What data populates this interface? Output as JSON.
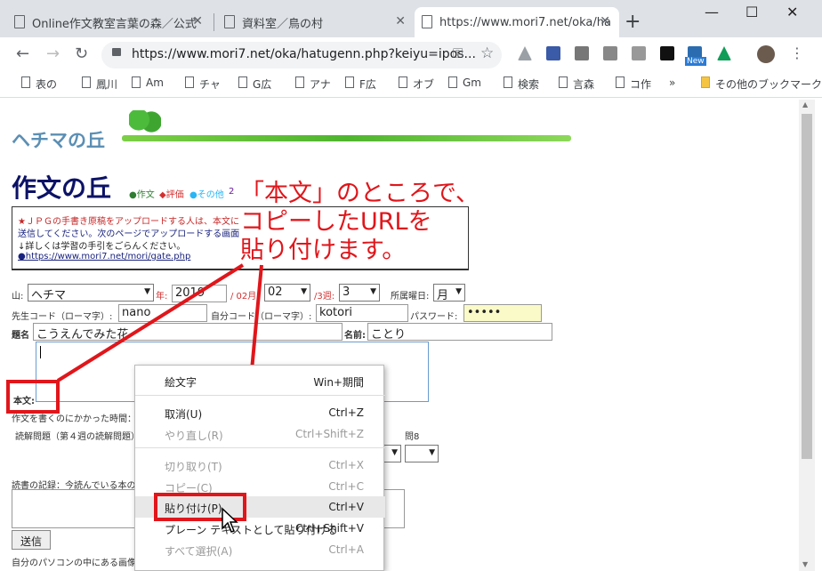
{
  "browser": {
    "tabs": [
      {
        "title": "Online作文教室言葉の森／公式"
      },
      {
        "title": "資料室／鳥の村"
      },
      {
        "title": "https://www.mori7.net/oka/ha"
      }
    ],
    "url": "https://www.mori7.net/oka/hatugenn.php?keiyu=ipos...",
    "bookmarks": [
      "表の",
      "鳳川",
      "Am",
      "チャ",
      "G広",
      "アナ",
      "F広",
      "オブ",
      "Gm",
      "検索",
      "言森",
      "コ作",
      "その他のブックマーク"
    ],
    "more_bookmarks": "»",
    "new_badge": "New",
    "new_tab": "+",
    "window_controls": {
      "minimize": "—",
      "maximize": "☐",
      "close": "✕"
    },
    "colors": {
      "tab_bar": "#dee1e6",
      "accent_red": "#e0161b"
    }
  },
  "page": {
    "logo_text": "ヘチマの丘",
    "site_title": "作文の丘",
    "nav_links": [
      "●作文",
      "◆評価",
      "●その他",
      "2"
    ],
    "notice": {
      "line1": "★ＪＰＧの手書き原稿をアップロードする人は、本文に",
      "line2": "送信してください。次のページでアップロードする画面",
      "line3": "↓詳しくは学習の手引をごらんください。",
      "link": "●https://www.mori7.net/mori/gate.php"
    },
    "form": {
      "mountain_label": "山:",
      "mountain_value": "ヘチマ",
      "year_label": "年:",
      "year_value": "2019",
      "month_label": "/ 02月:",
      "month_value": "02",
      "week_label": "/3週:",
      "week_value": "3",
      "weekday_label": "所属曜日:",
      "weekday_value": "月",
      "teacher_code_label": "先生コード（ローマ字）:",
      "teacher_code_value": "nano",
      "own_code_label": "自分コード（ローマ字）:",
      "own_code_value": "kotori",
      "password_label": "パスワード:",
      "password_value": "•••••",
      "title_label": "題名",
      "title_value": "こうえんでみた花",
      "name_label": "名前:",
      "name_value": "ことり",
      "body_label": "本文:",
      "time_label": "作文を書くのにかかった時間：",
      "reading_label": "読解問題（第４週の読解問題）",
      "q8_label": "問8",
      "reading_record_label": "読書の記録：今読んでいる本の",
      "submit_label": "送信",
      "bottom_note": "自分のパソコンの中にある画像"
    }
  },
  "context_menu": {
    "items": [
      {
        "label": "絵文字",
        "shortcut": "Win+期間",
        "enabled": true
      },
      {
        "label": "取消(U)",
        "shortcut": "Ctrl+Z",
        "enabled": true
      },
      {
        "label": "やり直し(R)",
        "shortcut": "Ctrl+Shift+Z",
        "enabled": false
      },
      {
        "label": "切り取り(T)",
        "shortcut": "Ctrl+X",
        "enabled": false
      },
      {
        "label": "コピー(C)",
        "shortcut": "Ctrl+C",
        "enabled": false
      },
      {
        "label": "貼り付け(P)",
        "shortcut": "Ctrl+V",
        "enabled": true
      },
      {
        "label": "プレーン テキストとして貼り付ける",
        "shortcut": "Ctrl+Shift+V",
        "enabled": true
      },
      {
        "label": "すべて選択(A)",
        "shortcut": "Ctrl+A",
        "enabled": false
      }
    ]
  },
  "annotation": {
    "text": "「本文」のところで、\nコピーしたURLを\n貼り付けます。"
  }
}
